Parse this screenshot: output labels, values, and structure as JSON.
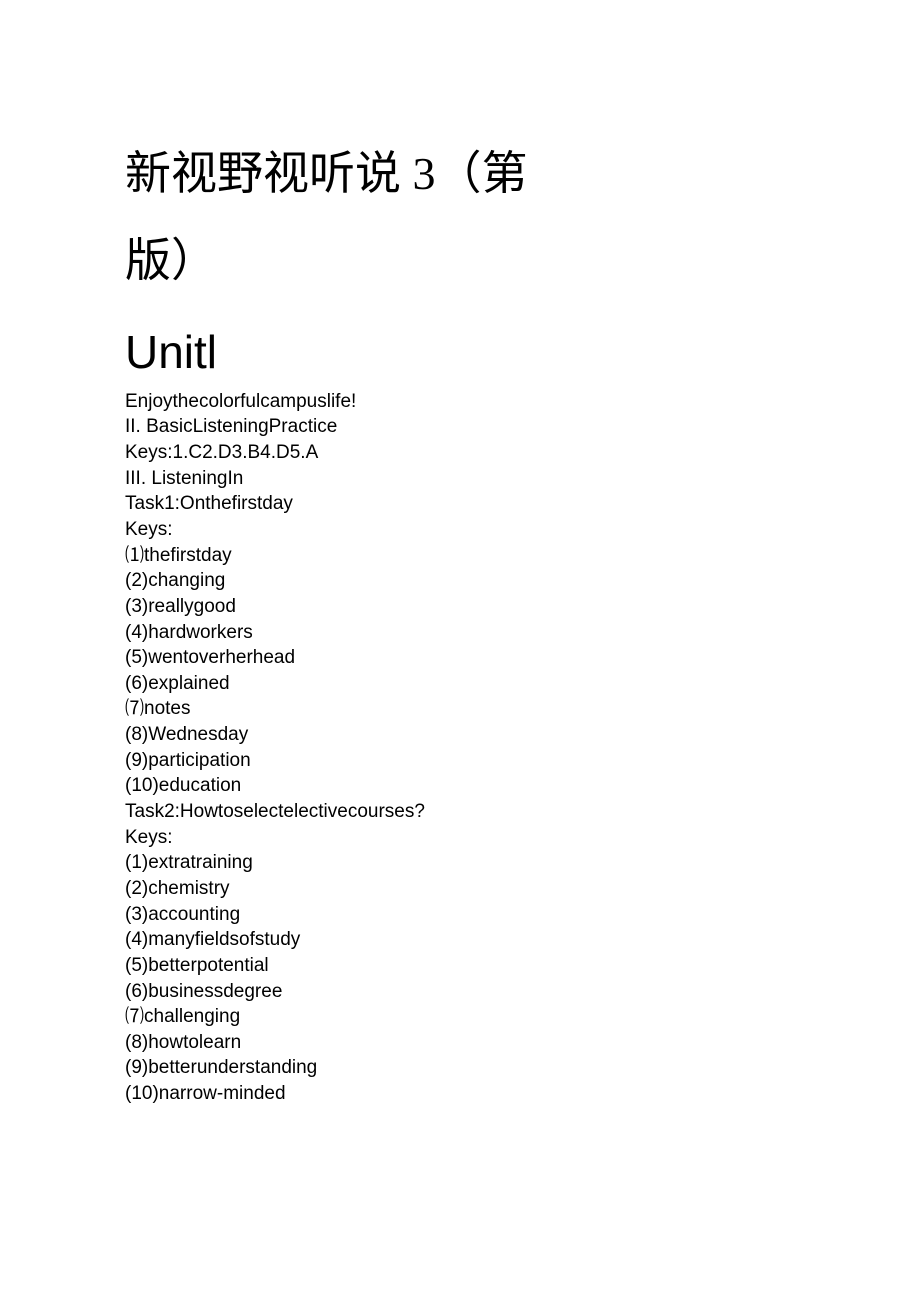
{
  "title": {
    "line1": "新视野视听说 3（第",
    "line2": "版）"
  },
  "unit_title": "Unitl",
  "lines": [
    "Enjoythecolorfulcampuslife!",
    "II. BasicListeningPractice",
    "Keys:1.C2.D3.B4.D5.A",
    "III. ListeningIn",
    "Task1:Onthefirstday",
    "Keys:"
  ],
  "list1": [
    {
      "n": "⑴",
      "txt": "thefirstday"
    },
    {
      "n": "(2)",
      "txt": "changing"
    },
    {
      "n": "(3)",
      "txt": "reallygood"
    },
    {
      "n": "(4)",
      "txt": "hardworkers"
    },
    {
      "n": "(5)",
      "txt": "wentoverherhead"
    },
    {
      "n": "(6)",
      "txt": "explained"
    },
    {
      "n": "⑺",
      "txt": "notes"
    },
    {
      "n": "(8)",
      "txt": "Wednesday"
    },
    {
      "n": "(9)",
      "txt": "participation"
    },
    {
      "n": "(10)",
      "txt": "education"
    }
  ],
  "lines2": [
    "Task2:Howtoselectelectivecourses?",
    "Keys:"
  ],
  "list2": [
    {
      "n": "(1)",
      "txt": "extratraining"
    },
    {
      "n": "(2)",
      "txt": "chemistry"
    },
    {
      "n": "(3)",
      "txt": "accounting"
    },
    {
      "n": "(4)",
      "txt": "manyfieldsofstudy"
    },
    {
      "n": "(5)",
      "txt": "betterpotential"
    },
    {
      "n": "(6)",
      "txt": "businessdegree"
    },
    {
      "n": "⑺",
      "txt": "challenging"
    },
    {
      "n": "(8)",
      "txt": "howtolearn"
    },
    {
      "n": "(9)",
      "txt": "betterunderstanding"
    },
    {
      "n": "(10)",
      "txt": "narrow-minded"
    }
  ]
}
